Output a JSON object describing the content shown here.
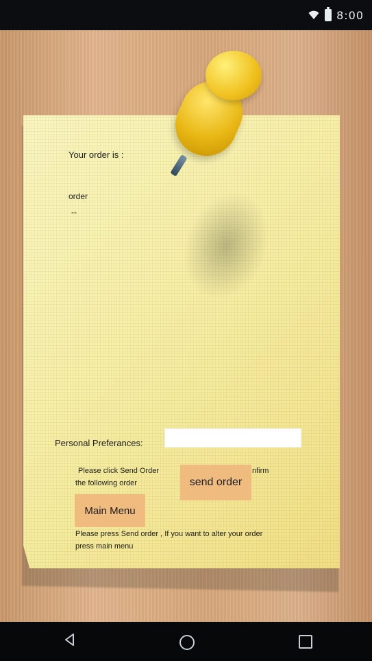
{
  "status_bar": {
    "time": "8:00",
    "icons": [
      "wifi-icon",
      "battery-icon"
    ]
  },
  "note": {
    "header": "Your order is :",
    "order_label": "order",
    "order_value": "--"
  },
  "preferences": {
    "label": "Personal Preferances:",
    "value": "",
    "placeholder": ""
  },
  "instructions": {
    "send_line1": "Please click Send Order",
    "send_line1_end": "nfirm",
    "send_line2": "the following order",
    "bottom_line1": "Please press Send order , If you want to alter your order",
    "bottom_line2": "press main menu"
  },
  "buttons": {
    "send_order": "send order",
    "main_menu": "Main Menu"
  },
  "colors": {
    "button_bg": "#f0bb7e",
    "note_bg": "#f7eea2",
    "pin": "#f0c11f"
  },
  "nav_bar": {
    "icons": [
      "back-icon",
      "home-icon",
      "recents-icon"
    ]
  }
}
